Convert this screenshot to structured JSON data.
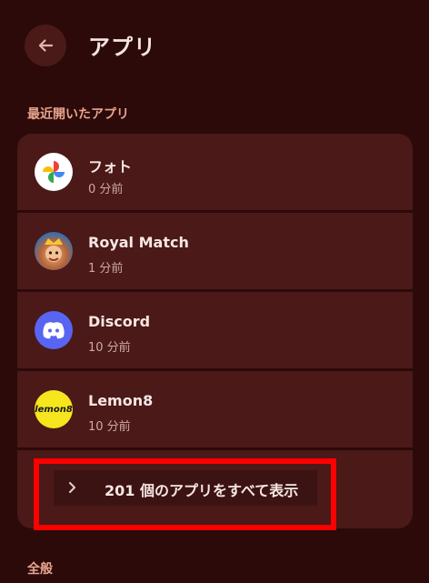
{
  "header": {
    "title": "アプリ"
  },
  "recent_section": {
    "label": "最近開いたアプリ"
  },
  "recent_apps": [
    {
      "name": "フォト",
      "time": "0 分前",
      "icon": "google-photos-icon"
    },
    {
      "name": "Royal Match",
      "time": "1 分前",
      "icon": "royal-match-icon"
    },
    {
      "name": "Discord",
      "time": "10 分前",
      "icon": "discord-icon"
    },
    {
      "name": "Lemon8",
      "time": "10 分前",
      "icon": "lemon8-icon",
      "icon_text": "lemon8"
    }
  ],
  "see_all": {
    "label": "201 個のアプリをすべて表示"
  },
  "general_section": {
    "label": "全般"
  },
  "colors": {
    "background": "#2c0a0a",
    "card": "#4a1918",
    "accent": "#e9a58e",
    "highlight": "#ff0000",
    "discord": "#5865f2",
    "lemon8": "#f5e61e"
  }
}
